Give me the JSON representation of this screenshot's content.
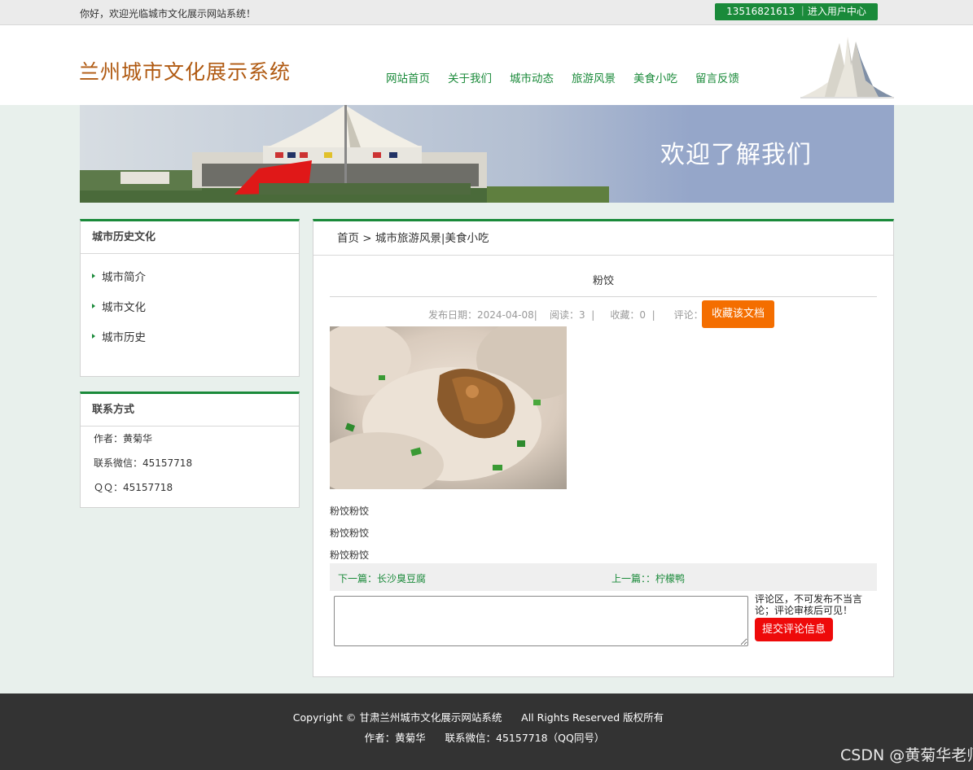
{
  "topbar": {
    "welcome": "你好，欢迎光临城市文化展示网站系统！",
    "user_center": "13516821613 ｜进入用户中心"
  },
  "header": {
    "site_title": "兰州城市文化展示系统",
    "nav": [
      "网站首页",
      "关于我们",
      "城市动态",
      "旅游风景",
      "美食小吃",
      "留言反馈"
    ]
  },
  "banner": {
    "text": "欢迎了解我们"
  },
  "sidebar": {
    "history_title": "城市历史文化",
    "history_items": [
      "城市简介",
      "城市文化",
      "城市历史"
    ],
    "contact_title": "联系方式",
    "contact": [
      "作者：黄菊华",
      "联系微信：45157718",
      "ＱＱ：45157718"
    ]
  },
  "main": {
    "breadcrumb": "首页 > 城市旅游风景|美食小吃",
    "title": "粉饺",
    "meta": "发布日期：2024-04-08|    阅读：3  |     收藏：0  |      评论：0",
    "fav_button": "收藏该文档",
    "paragraphs": [
      "粉饺粉饺",
      "粉饺粉饺",
      "粉饺粉饺"
    ],
    "next": "下一篇：长沙臭豆腐",
    "prev": "上一篇：：柠檬鸭",
    "comment_note": "评论区，不可发布不当言论；评论审核后可见！",
    "submit_button": "提交评论信息"
  },
  "footer": {
    "line1": "Copyright © 甘肃兰州城市文化展示网站系统      All Rights Reserved 版权所有",
    "line2": "作者：黄菊华      联系微信：45157718（QQ同号）",
    "watermark": "CSDN @黄菊华老师"
  },
  "colors": {
    "accent_green": "#1a8a3a",
    "title_brown": "#b05a12",
    "orange_button": "#f46e00",
    "red_button": "#ee0a0a",
    "footer_bg": "#333333"
  }
}
